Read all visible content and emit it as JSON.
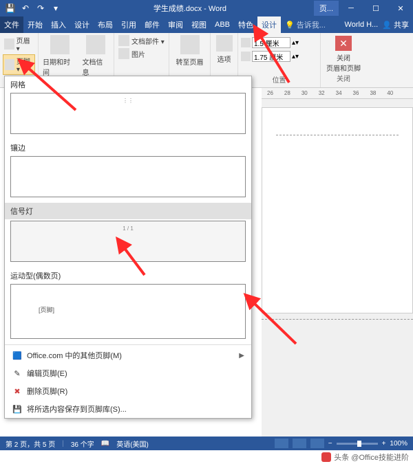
{
  "titlebar": {
    "doc_title": "学生成绩.docx - Word",
    "tool_tab": "页..."
  },
  "menu": {
    "file": "文件",
    "items": [
      "开始",
      "插入",
      "设计",
      "布局",
      "引用",
      "邮件",
      "审阅",
      "视图",
      "ABB",
      "特色"
    ],
    "active": "设计",
    "tell_me": "告诉我...",
    "account": "World H...",
    "share": "共享"
  },
  "ribbon": {
    "header_btn": "页眉 ▾",
    "footer_btn": "页脚 ▾",
    "datetime": "日期和时间",
    "docinfo": "文档信息",
    "docparts": "文档部件 ▾",
    "picture": "图片",
    "goto": "转至页眉",
    "options": "选项",
    "spin1_label": "",
    "spin1_value": "1.5 厘米",
    "spin2_value": "1.75 厘米",
    "pos_label": "位置",
    "close_label": "关闭",
    "close_text": "关闭\n页眉和页脚"
  },
  "dropdown": {
    "sec1": "网格",
    "sec2": "镶边",
    "sec3": "信号灯",
    "sec4": "运动型(偶数页)",
    "tab_text": "[页脚]",
    "office_more": "Office.com 中的其他页脚(M)",
    "edit_footer": "编辑页脚(E)",
    "remove_footer": "删除页脚(R)",
    "save_selection": "将所选内容保存到页脚库(S)..."
  },
  "ruler": {
    "marks": [
      "26",
      "28",
      "30",
      "32",
      "34",
      "36",
      "38",
      "40"
    ]
  },
  "status": {
    "page": "第 2 页，共 5 页",
    "chars": "36 个字",
    "lang": "英语(美国)",
    "zoom": "100%"
  },
  "attribution": "头条 @Office技能进阶"
}
